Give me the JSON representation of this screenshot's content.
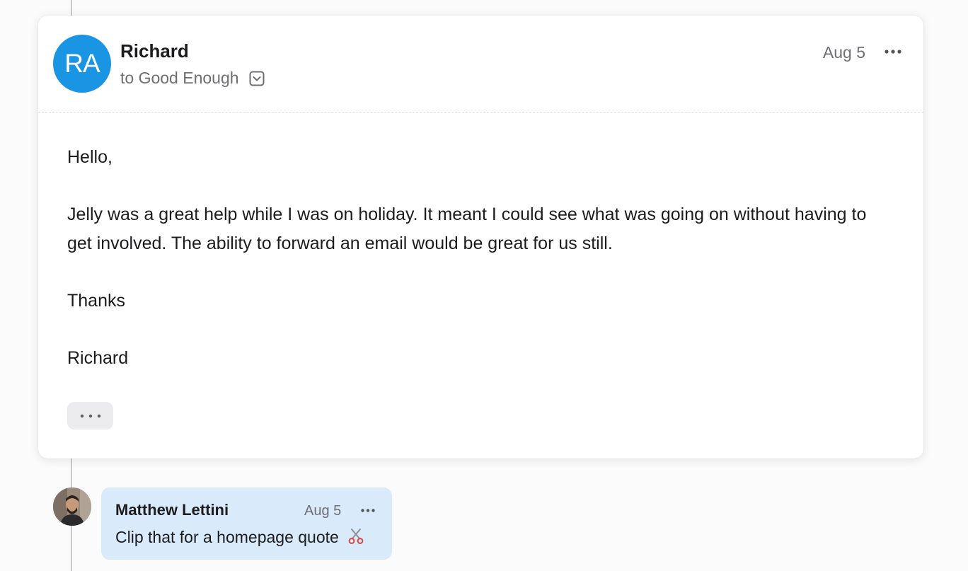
{
  "email": {
    "avatar_initials": "RA",
    "sender": "Richard",
    "recipient": "to Good Enough",
    "date": "Aug 5",
    "body": [
      "Hello,",
      "Jelly was a great help while I was on holiday. It meant I could see what was going on without having to get involved. The ability to forward an email would be great for us still.",
      "Thanks",
      "Richard"
    ],
    "show_quoted_label": "•••"
  },
  "comment": {
    "author": "Matthew Lettini",
    "date": "Aug 5",
    "text": "Clip that for a homepage quote"
  },
  "colors": {
    "avatar": "#1a95e3",
    "comment_bubble": "#d9eafa",
    "timeline": "#c9c9cb"
  },
  "icons": [
    "chevron-down-box-icon",
    "more-horizontal-icon",
    "scissors-icon"
  ]
}
